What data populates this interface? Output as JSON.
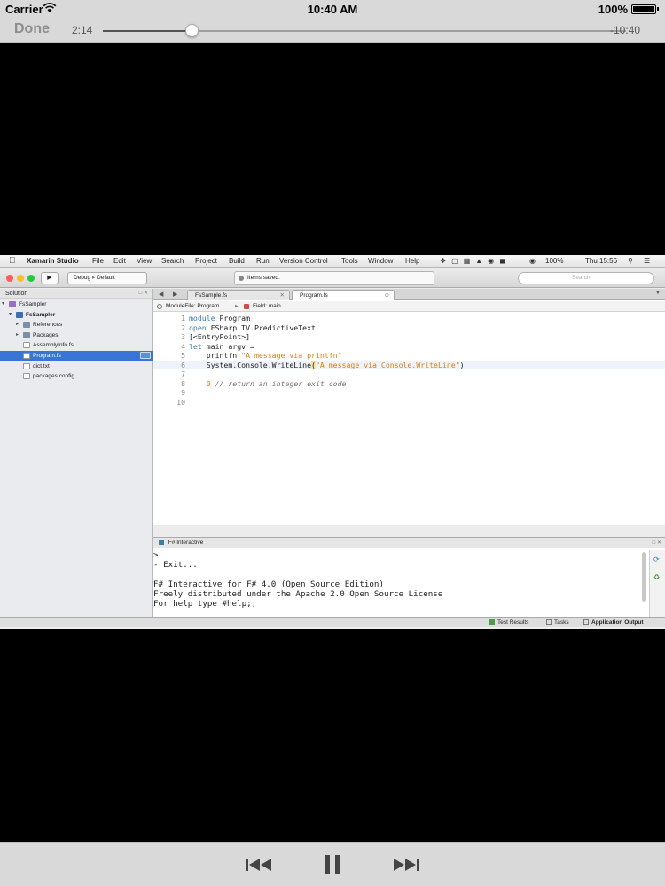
{
  "status_bar": {
    "carrier": "Carrier",
    "time": "10:40 AM",
    "battery": "100%"
  },
  "player": {
    "done_label": "Done",
    "elapsed": "2:14",
    "remaining": "-10:40",
    "progress_fraction": 0.17
  },
  "ide": {
    "mac_menu": {
      "app_name": "Xamarin Studio",
      "items": [
        "File",
        "Edit",
        "View",
        "Search",
        "Project",
        "Build",
        "Run",
        "Version Control",
        "Tools",
        "Window",
        "Help"
      ],
      "tray_battery": "100%",
      "tray_clock": "Thu 15:56"
    },
    "toolbar": {
      "config": "Debug",
      "target": "Default",
      "status": "Items saved.",
      "search_placeholder": "Search"
    },
    "solution_pad": {
      "title": "Solution",
      "tree": [
        {
          "label": "FsSampler",
          "depth": 0,
          "expanded": true,
          "icon": "solution-icon"
        },
        {
          "label": "FsSampler",
          "depth": 1,
          "expanded": true,
          "icon": "project-icon",
          "bold": true
        },
        {
          "label": "References",
          "depth": 2,
          "expanded": false,
          "icon": "folder-icon"
        },
        {
          "label": "Packages",
          "depth": 2,
          "expanded": false,
          "icon": "folder-icon"
        },
        {
          "label": "AssemblyInfo.fs",
          "depth": 2,
          "icon": "file-icon"
        },
        {
          "label": "Program.fs",
          "depth": 2,
          "icon": "file-icon",
          "selected": true
        },
        {
          "label": "dict.txt",
          "depth": 2,
          "icon": "file-icon"
        },
        {
          "label": "packages.config",
          "depth": 2,
          "icon": "file-icon"
        }
      ]
    },
    "tabs": [
      {
        "label": "FsSample.fs",
        "active": false
      },
      {
        "label": "Program.fs",
        "active": true
      }
    ],
    "pathbar": {
      "module": "ModuleFile: Program",
      "field": "Field: main"
    },
    "code_lines": [
      {
        "n": "1",
        "parts": [
          [
            "kw",
            "module"
          ],
          [
            "",
            " Program"
          ]
        ]
      },
      {
        "n": "2",
        "parts": [
          [
            "kw",
            "open"
          ],
          [
            "",
            " FSharp.TV.PredictiveText"
          ]
        ]
      },
      {
        "n": "3",
        "parts": [
          [
            "",
            "[<EntryPoint>]"
          ]
        ]
      },
      {
        "n": "4",
        "parts": [
          [
            "kw",
            "let"
          ],
          [
            "",
            " main argv ="
          ]
        ]
      },
      {
        "n": "5",
        "parts": [
          [
            "",
            "    printfn "
          ],
          [
            "str",
            "\"A message via printfn\""
          ]
        ]
      },
      {
        "n": "6",
        "parts": [
          [
            "",
            "    System.Console.WriteLine"
          ],
          [
            "brk",
            "("
          ],
          [
            "str",
            "\"A message via Console.WriteLine\""
          ],
          [
            "",
            ")"
          ]
        ],
        "current": true
      },
      {
        "n": "7",
        "parts": []
      },
      {
        "n": "8",
        "parts": [
          [
            "num",
            "    0"
          ],
          [
            "cmt",
            " // return an integer exit code"
          ]
        ]
      },
      {
        "n": "9",
        "parts": []
      },
      {
        "n": "10",
        "parts": []
      }
    ],
    "fsi": {
      "title": "F# Interactive",
      "lines": [
        ">",
        "- Exit...",
        "",
        "F# Interactive for F# 4.0 (Open Source Edition)",
        "Freely distributed under the Apache 2.0 Open Source License",
        "For help type #help;;"
      ]
    },
    "statusbar": {
      "test_results": "Test Results",
      "tasks": "Tasks",
      "app_output": "Application Output"
    }
  },
  "colors": {
    "selection": "#3875d7",
    "keyword": "#3b7fa8",
    "string": "#d9820e"
  }
}
